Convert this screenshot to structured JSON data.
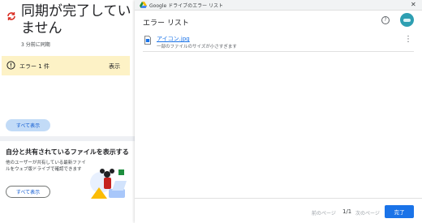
{
  "sync": {
    "title": "同期が完了していません",
    "subtitle": "3 分前に同期",
    "error_label": "エラー 1 件",
    "error_action": "表示",
    "show_all": "すべて表示"
  },
  "shared": {
    "title": "自分と共有されているファイルを表示する",
    "description": "他のユーザーが共有している最新ファイルをウェブ版ドライブで確認できます",
    "show_all": "すべて表示"
  },
  "dialog": {
    "window_title": "Google ドライブのエラー リスト",
    "heading": "エラー リスト",
    "files": [
      {
        "name": "アイコン.jpg",
        "error": "一部のファイルのサイズが小さすぎます"
      }
    ],
    "pager": {
      "prev": "前のページ",
      "page": "1/1",
      "next": "次のページ"
    },
    "done": "完了"
  },
  "colors": {
    "accent": "#1a73e8",
    "warning_bg": "#fdf2c6",
    "sync_error": "#d93025"
  },
  "icons": [
    "sync-error-icon",
    "error-circle-icon",
    "drive-logo-icon",
    "close-icon",
    "help-icon",
    "avatar",
    "image-file-icon",
    "more-vert-icon"
  ]
}
